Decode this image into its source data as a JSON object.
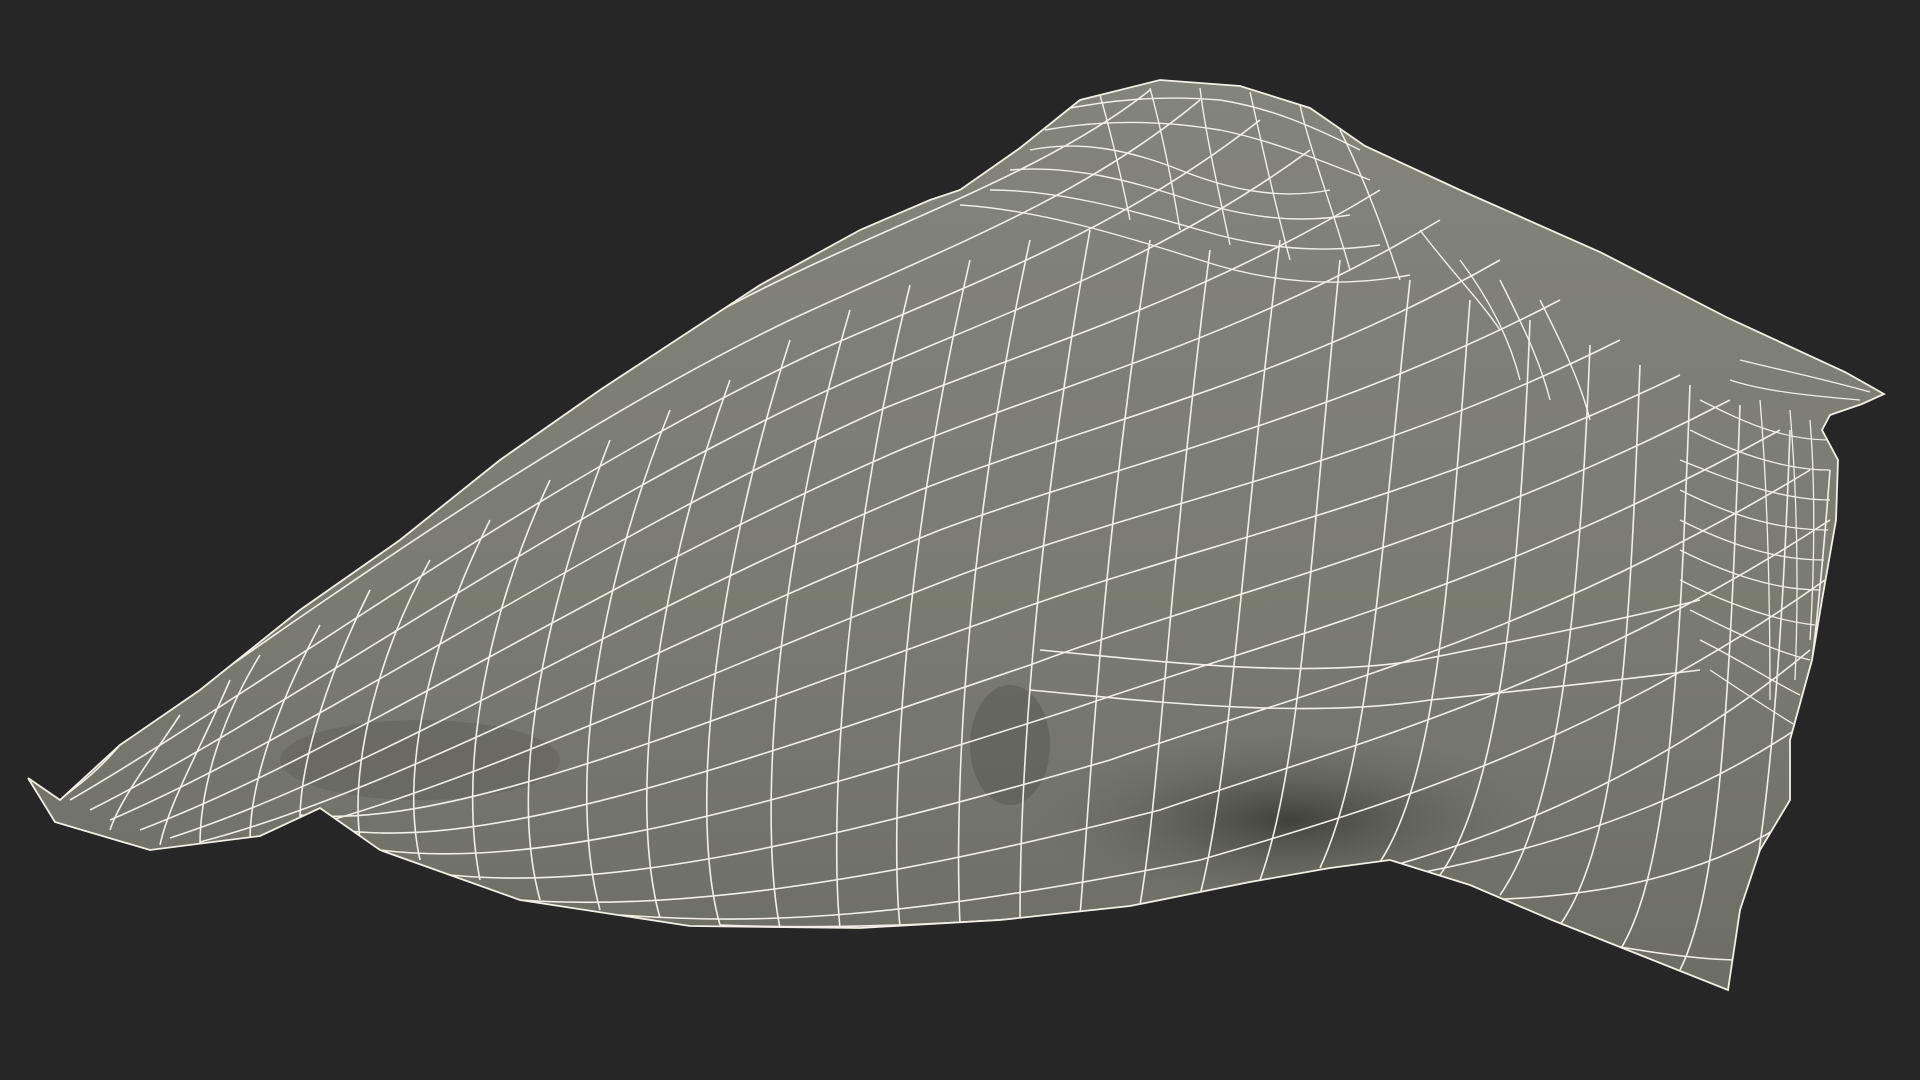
{
  "scene": {
    "background_color": "#262626",
    "mesh_fill_color": "#7b7c71",
    "mesh_shadow_color": "#55564e",
    "wireframe_color": "#f2f0e6",
    "object": "draped-cloth-wireframe"
  }
}
